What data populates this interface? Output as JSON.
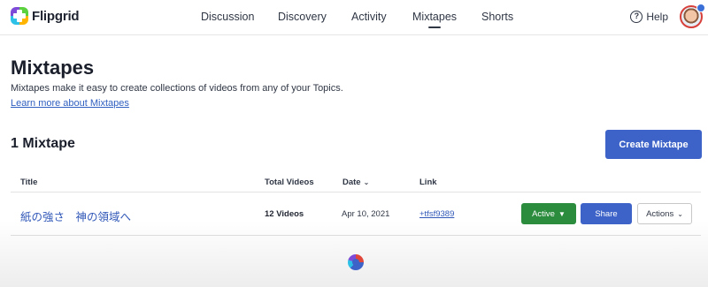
{
  "brand": {
    "name": "Flipgrid"
  },
  "nav": {
    "items": [
      {
        "label": "Discussion"
      },
      {
        "label": "Discovery"
      },
      {
        "label": "Activity"
      },
      {
        "label": "Mixtapes"
      },
      {
        "label": "Shorts"
      }
    ],
    "active": "Mixtapes",
    "help_label": "Help"
  },
  "page": {
    "title": "Mixtapes",
    "description": "Mixtapes make it easy to create collections of videos from any of your Topics.",
    "learn_more": "Learn more about Mixtapes",
    "count_label": "1 Mixtape",
    "create_button": "Create Mixtape"
  },
  "table": {
    "headers": {
      "title": "Title",
      "total_videos": "Total Videos",
      "date": "Date",
      "link": "Link"
    },
    "rows": [
      {
        "title": "紙の強さ　神の領域へ",
        "total_videos": "12 Videos",
        "date": "Apr 10, 2021",
        "link": "+tfsf9389",
        "status": "Active",
        "share": "Share",
        "actions": "Actions"
      }
    ]
  },
  "colors": {
    "primary": "#3d63c8",
    "active_green": "#2c8c3e",
    "link_blue": "#3158b8"
  }
}
